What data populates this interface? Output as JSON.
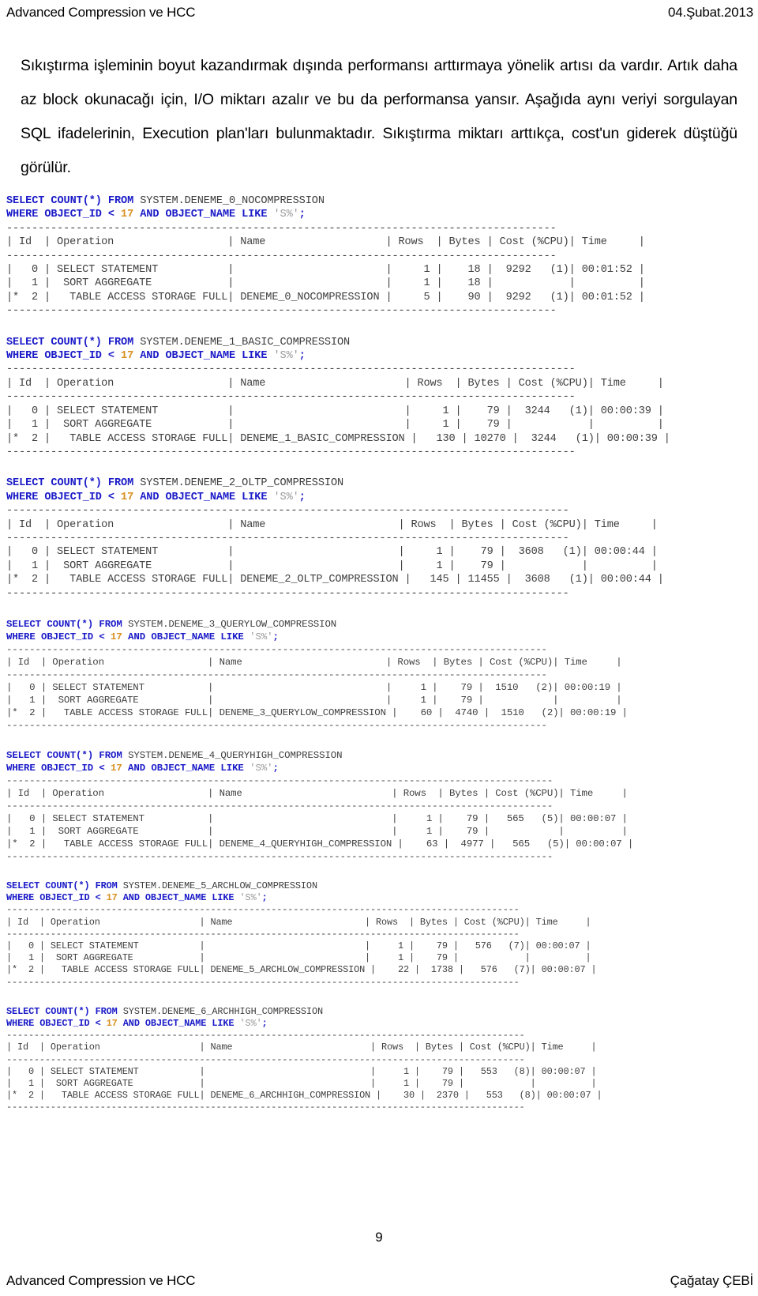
{
  "header": {
    "left": "Advanced Compression ve HCC",
    "right": "04.Şubat.2013"
  },
  "body": {
    "paragraph": "Sıkıştırma işleminin boyut kazandırmak dışında performansı arttırmaya yönelik artısı da vardır. Artık daha az block okunacağı için, I/O miktarı azalır ve bu da performansa yansır. Aşağıda aynı veriyi sorgulayan SQL ifadelerinin, Execution plan'ları bulunmaktadır. Sıkıştırma miktarı arttıkça, cost'un giderek düştüğü görülür."
  },
  "footer": {
    "left": "Advanced Compression ve HCC",
    "right": "Çağatay ÇEBİ",
    "page_number": "9"
  },
  "colors": {
    "keyword": "#1a1ac8",
    "identifier": "#3c3c3c",
    "number": "#d89020",
    "string": "#9a9a9a",
    "table": "#3f3f3f"
  },
  "plan_table": {
    "columns": [
      "Id",
      "Operation",
      "Name",
      "Rows",
      "Bytes",
      "Cost (%CPU)",
      "Time"
    ]
  },
  "blocks": [
    {
      "id": "block-0-nocompression",
      "size_class": "sz-a",
      "sql": {
        "line1_prefix": "SELECT COUNT(*) FROM ",
        "line1_object": "SYSTEM.DENEME_0_NOCOMPRESSION",
        "line2_a": "WHERE OBJECT_ID < ",
        "line2_num": "17",
        "line2_b": " AND OBJECT_NAME LIKE ",
        "line2_str": "'S%'",
        "line2_end": ";"
      },
      "plan_text": "---------------------------------------------------------------------------------------\n| Id  | Operation                  | Name                   | Rows  | Bytes | Cost (%CPU)| Time     |\n---------------------------------------------------------------------------------------\n|   0 | SELECT STATEMENT           |                        |     1 |    18 |  9292   (1)| 00:01:52 |\n|   1 |  SORT AGGREGATE            |                        |     1 |    18 |            |          |\n|*  2 |   TABLE ACCESS STORAGE FULL| DENEME_0_NOCOMPRESSION |     5 |    90 |  9292   (1)| 00:01:52 |\n---------------------------------------------------------------------------------------",
      "rows": [
        {
          "id": "0",
          "operation": "SELECT STATEMENT",
          "name": "",
          "rows": "1",
          "bytes": "18",
          "cost": "9292",
          "cpu": "(1)",
          "time": "00:01:52"
        },
        {
          "id": "1",
          "operation": "SORT AGGREGATE",
          "name": "",
          "rows": "1",
          "bytes": "18",
          "cost": "",
          "cpu": "",
          "time": ""
        },
        {
          "id": "* 2",
          "operation": "TABLE ACCESS STORAGE FULL",
          "name": "DENEME_0_NOCOMPRESSION",
          "rows": "5",
          "bytes": "90",
          "cost": "9292",
          "cpu": "(1)",
          "time": "00:01:52"
        }
      ]
    },
    {
      "id": "block-1-basic",
      "size_class": "sz-a",
      "sql": {
        "line1_prefix": "SELECT COUNT(*) FROM ",
        "line1_object": "SYSTEM.DENEME_1_BASIC_COMPRESSION",
        "line2_a": "WHERE OBJECT_ID < ",
        "line2_num": "17",
        "line2_b": " AND OBJECT_NAME LIKE ",
        "line2_str": "'S%'",
        "line2_end": ";"
      },
      "plan_text": "------------------------------------------------------------------------------------------\n| Id  | Operation                  | Name                      | Rows  | Bytes | Cost (%CPU)| Time     |\n------------------------------------------------------------------------------------------\n|   0 | SELECT STATEMENT           |                           |     1 |    79 |  3244   (1)| 00:00:39 |\n|   1 |  SORT AGGREGATE            |                           |     1 |    79 |            |          |\n|*  2 |   TABLE ACCESS STORAGE FULL| DENEME_1_BASIC_COMPRESSION |   130 | 10270 |  3244   (1)| 00:00:39 |\n------------------------------------------------------------------------------------------",
      "rows": [
        {
          "id": "0",
          "operation": "SELECT STATEMENT",
          "name": "",
          "rows": "1",
          "bytes": "79",
          "cost": "3244",
          "cpu": "(1)",
          "time": "00:00:39"
        },
        {
          "id": "1",
          "operation": "SORT AGGREGATE",
          "name": "",
          "rows": "1",
          "bytes": "79",
          "cost": "",
          "cpu": "",
          "time": ""
        },
        {
          "id": "* 2",
          "operation": "TABLE ACCESS STORAGE FULL",
          "name": "DENEME_1_BASIC_COMPRESSION",
          "rows": "130",
          "bytes": "10270",
          "cost": "3244",
          "cpu": "(1)",
          "time": "00:00:39"
        }
      ]
    },
    {
      "id": "block-2-oltp",
      "size_class": "sz-a",
      "sql": {
        "line1_prefix": "SELECT COUNT(*) FROM ",
        "line1_object": "SYSTEM.DENEME_2_OLTP_COMPRESSION",
        "line2_a": "WHERE OBJECT_ID < ",
        "line2_num": "17",
        "line2_b": " AND OBJECT_NAME LIKE ",
        "line2_str": "'S%'",
        "line2_end": ";"
      },
      "plan_text": "-----------------------------------------------------------------------------------------\n| Id  | Operation                  | Name                     | Rows  | Bytes | Cost (%CPU)| Time     |\n-----------------------------------------------------------------------------------------\n|   0 | SELECT STATEMENT           |                          |     1 |    79 |  3608   (1)| 00:00:44 |\n|   1 |  SORT AGGREGATE            |                          |     1 |    79 |            |          |\n|*  2 |   TABLE ACCESS STORAGE FULL| DENEME_2_OLTP_COMPRESSION |   145 | 11455 |  3608   (1)| 00:00:44 |\n-----------------------------------------------------------------------------------------",
      "rows": [
        {
          "id": "0",
          "operation": "SELECT STATEMENT",
          "name": "",
          "rows": "1",
          "bytes": "79",
          "cost": "3608",
          "cpu": "(1)",
          "time": "00:00:44"
        },
        {
          "id": "1",
          "operation": "SORT AGGREGATE",
          "name": "",
          "rows": "1",
          "bytes": "79",
          "cost": "",
          "cpu": "",
          "time": ""
        },
        {
          "id": "* 2",
          "operation": "TABLE ACCESS STORAGE FULL",
          "name": "DENEME_2_OLTP_COMPRESSION",
          "rows": "145",
          "bytes": "11455",
          "cost": "3608",
          "cpu": "(1)",
          "time": "00:00:44"
        }
      ]
    },
    {
      "id": "block-3-querylow",
      "size_class": "sz-b",
      "sql": {
        "line1_prefix": "SELECT COUNT(*) FROM ",
        "line1_object": "SYSTEM.DENEME_3_QUERYLOW_COMPRESSION",
        "line2_a": "WHERE OBJECT_ID < ",
        "line2_num": "17",
        "line2_b": " AND OBJECT_NAME LIKE ",
        "line2_str": "'S%'",
        "line2_end": ";"
      },
      "plan_text": "----------------------------------------------------------------------------------------------\n| Id  | Operation                  | Name                         | Rows  | Bytes | Cost (%CPU)| Time     |\n----------------------------------------------------------------------------------------------\n|   0 | SELECT STATEMENT           |                              |     1 |    79 |  1510   (2)| 00:00:19 |\n|   1 |  SORT AGGREGATE            |                              |     1 |    79 |            |          |\n|*  2 |   TABLE ACCESS STORAGE FULL| DENEME_3_QUERYLOW_COMPRESSION |    60 |  4740 |  1510   (2)| 00:00:19 |\n----------------------------------------------------------------------------------------------",
      "rows": [
        {
          "id": "0",
          "operation": "SELECT STATEMENT",
          "name": "",
          "rows": "1",
          "bytes": "79",
          "cost": "1510",
          "cpu": "(2)",
          "time": "00:00:19"
        },
        {
          "id": "1",
          "operation": "SORT AGGREGATE",
          "name": "",
          "rows": "1",
          "bytes": "79",
          "cost": "",
          "cpu": "",
          "time": ""
        },
        {
          "id": "* 2",
          "operation": "TABLE ACCESS STORAGE FULL",
          "name": "DENEME_3_QUERYLOW_COMPRESSION",
          "rows": "60",
          "bytes": "4740",
          "cost": "1510",
          "cpu": "(2)",
          "time": "00:00:19"
        }
      ]
    },
    {
      "id": "block-4-queryhigh",
      "size_class": "sz-b",
      "sql": {
        "line1_prefix": "SELECT COUNT(*) FROM ",
        "line1_object": "SYSTEM.DENEME_4_QUERYHIGH_COMPRESSION",
        "line2_a": "WHERE OBJECT_ID < ",
        "line2_num": "17",
        "line2_b": " AND OBJECT_NAME LIKE ",
        "line2_str": "'S%'",
        "line2_end": ";"
      },
      "plan_text": "-----------------------------------------------------------------------------------------------\n| Id  | Operation                  | Name                          | Rows  | Bytes | Cost (%CPU)| Time     |\n-----------------------------------------------------------------------------------------------\n|   0 | SELECT STATEMENT           |                               |     1 |    79 |   565   (5)| 00:00:07 |\n|   1 |  SORT AGGREGATE            |                               |     1 |    79 |            |          |\n|*  2 |   TABLE ACCESS STORAGE FULL| DENEME_4_QUERYHIGH_COMPRESSION |    63 |  4977 |   565   (5)| 00:00:07 |\n-----------------------------------------------------------------------------------------------",
      "rows": [
        {
          "id": "0",
          "operation": "SELECT STATEMENT",
          "name": "",
          "rows": "1",
          "bytes": "79",
          "cost": "565",
          "cpu": "(5)",
          "time": "00:00:07"
        },
        {
          "id": "1",
          "operation": "SORT AGGREGATE",
          "name": "",
          "rows": "1",
          "bytes": "79",
          "cost": "",
          "cpu": "",
          "time": ""
        },
        {
          "id": "* 2",
          "operation": "TABLE ACCESS STORAGE FULL",
          "name": "DENEME_4_QUERYHIGH_COMPRESSION",
          "rows": "63",
          "bytes": "4977",
          "cost": "565",
          "cpu": "(5)",
          "time": "00:00:07"
        }
      ]
    },
    {
      "id": "block-5-archlow",
      "size_class": "sz-c",
      "sql": {
        "line1_prefix": "SELECT COUNT(*) FROM ",
        "line1_object": "SYSTEM.DENEME_5_ARCHLOW_COMPRESSION",
        "line2_a": "WHERE OBJECT_ID < ",
        "line2_num": "17",
        "line2_b": " AND OBJECT_NAME LIKE ",
        "line2_str": "'S%'",
        "line2_end": ";"
      },
      "plan_text": "---------------------------------------------------------------------------------------------\n| Id  | Operation                  | Name                        | Rows  | Bytes | Cost (%CPU)| Time     |\n---------------------------------------------------------------------------------------------\n|   0 | SELECT STATEMENT           |                             |     1 |    79 |   576   (7)| 00:00:07 |\n|   1 |  SORT AGGREGATE            |                             |     1 |    79 |            |          |\n|*  2 |   TABLE ACCESS STORAGE FULL| DENEME_5_ARCHLOW_COMPRESSION |    22 |  1738 |   576   (7)| 00:00:07 |\n---------------------------------------------------------------------------------------------",
      "rows": [
        {
          "id": "0",
          "operation": "SELECT STATEMENT",
          "name": "",
          "rows": "1",
          "bytes": "79",
          "cost": "576",
          "cpu": "(7)",
          "time": "00:00:07"
        },
        {
          "id": "1",
          "operation": "SORT AGGREGATE",
          "name": "",
          "rows": "1",
          "bytes": "79",
          "cost": "",
          "cpu": "",
          "time": ""
        },
        {
          "id": "* 2",
          "operation": "TABLE ACCESS STORAGE FULL",
          "name": "DENEME_5_ARCHLOW_COMPRESSION",
          "rows": "22",
          "bytes": "1738",
          "cost": "576",
          "cpu": "(7)",
          "time": "00:00:07"
        }
      ]
    },
    {
      "id": "block-6-archhigh",
      "size_class": "sz-c",
      "sql": {
        "line1_prefix": "SELECT COUNT(*) FROM ",
        "line1_object": "SYSTEM.DENEME_6_ARCHHIGH_COMPRESSION",
        "line2_a": "WHERE OBJECT_ID < ",
        "line2_num": "17",
        "line2_b": " AND OBJECT_NAME LIKE ",
        "line2_str": "'S%'",
        "line2_end": ";"
      },
      "plan_text": "----------------------------------------------------------------------------------------------\n| Id  | Operation                  | Name                         | Rows  | Bytes | Cost (%CPU)| Time     |\n----------------------------------------------------------------------------------------------\n|   0 | SELECT STATEMENT           |                              |     1 |    79 |   553   (8)| 00:00:07 |\n|   1 |  SORT AGGREGATE            |                              |     1 |    79 |            |          |\n|*  2 |   TABLE ACCESS STORAGE FULL| DENEME_6_ARCHHIGH_COMPRESSION |    30 |  2370 |   553   (8)| 00:00:07 |\n----------------------------------------------------------------------------------------------",
      "rows": [
        {
          "id": "0",
          "operation": "SELECT STATEMENT",
          "name": "",
          "rows": "1",
          "bytes": "79",
          "cost": "553",
          "cpu": "(8)",
          "time": "00:00:07"
        },
        {
          "id": "1",
          "operation": "SORT AGGREGATE",
          "name": "",
          "rows": "1",
          "bytes": "79",
          "cost": "",
          "cpu": "",
          "time": ""
        },
        {
          "id": "* 2",
          "operation": "TABLE ACCESS STORAGE FULL",
          "name": "DENEME_6_ARCHHIGH_COMPRESSION",
          "rows": "30",
          "bytes": "2370",
          "cost": "553",
          "cpu": "(8)",
          "time": "00:00:07"
        }
      ]
    }
  ]
}
